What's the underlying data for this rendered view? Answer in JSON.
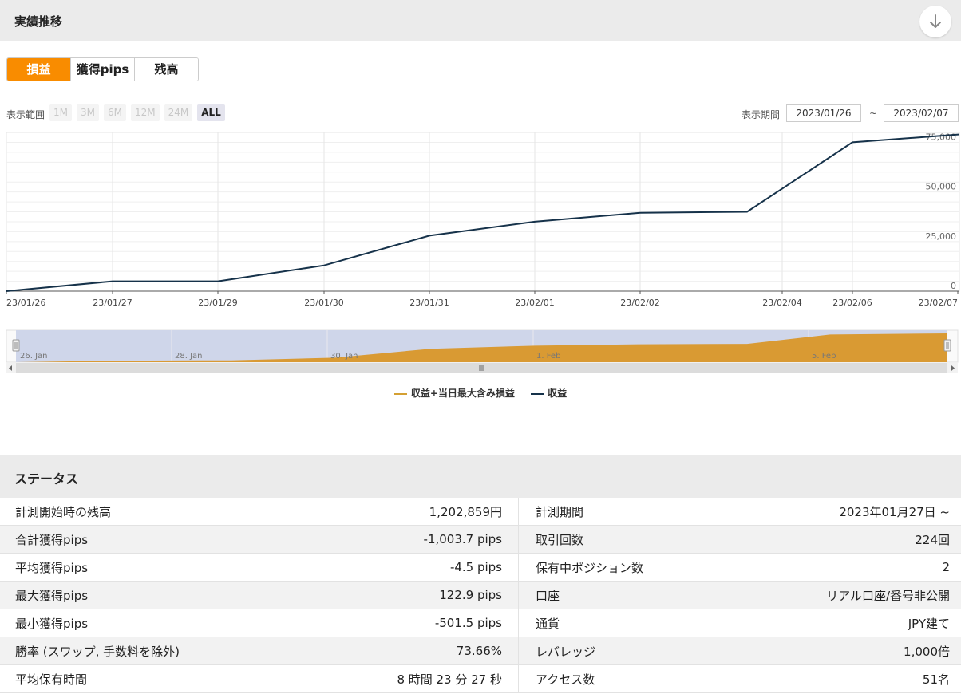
{
  "performance_section": {
    "title": "実績推移"
  },
  "tabs": [
    {
      "label": "損益",
      "active": true
    },
    {
      "label": "獲得pips",
      "active": false
    },
    {
      "label": "残高",
      "active": false
    }
  ],
  "range": {
    "label": "表示範囲",
    "buttons": [
      {
        "label": "1M",
        "active": false
      },
      {
        "label": "3M",
        "active": false
      },
      {
        "label": "6M",
        "active": false
      },
      {
        "label": "12M",
        "active": false
      },
      {
        "label": "24M",
        "active": false
      },
      {
        "label": "ALL",
        "active": true
      }
    ]
  },
  "period": {
    "label": "表示期間",
    "from": "2023/01/26",
    "separator": "~",
    "to": "2023/02/07"
  },
  "chart_data": {
    "type": "line",
    "title": "",
    "xlabel": "",
    "ylabel": "",
    "x_tick_labels": [
      "23/01/26",
      "23/01/27",
      "23/01/29",
      "23/01/30",
      "23/01/31",
      "23/02/01",
      "23/02/02",
      "23/02/04",
      "23/02/06",
      "23/02/07"
    ],
    "y_tick_labels": [
      "0",
      "25,000",
      "50,000",
      "75,000"
    ],
    "y_ticks": [
      0,
      25000,
      50000,
      75000
    ],
    "ylim": [
      0,
      80000
    ],
    "series": [
      {
        "name": "収益",
        "color": "#16324a",
        "points": [
          {
            "x": "2023-01-26",
            "y": 0
          },
          {
            "x": "2023-01-27",
            "y": 5000
          },
          {
            "x": "2023-01-29",
            "y": 5000
          },
          {
            "x": "2023-01-30",
            "y": 13000
          },
          {
            "x": "2023-01-31",
            "y": 28000
          },
          {
            "x": "2023-02-01",
            "y": 35000
          },
          {
            "x": "2023-02-02",
            "y": 39500
          },
          {
            "x": "2023-02-03",
            "y": 40000
          },
          {
            "x": "2023-02-06",
            "y": 75000
          },
          {
            "x": "2023-02-07",
            "y": 79000
          }
        ]
      },
      {
        "name": "収益+当日最大含み損益",
        "color": "#d4a033"
      }
    ],
    "grid": true,
    "legend_position": "bottom",
    "navigator": {
      "labels": [
        "26. Jan",
        "28. Jan",
        "30. Jan",
        "1. Feb",
        "5. Feb"
      ],
      "fill_color": "#d99a33",
      "selection_color": "#cfd6ea"
    }
  },
  "status_section": {
    "title": "ステータス",
    "rows": [
      {
        "label": "計測開始時の残高",
        "value": "1,202,859円",
        "label2": "計測期間",
        "value2": "2023年01月27日 ~"
      },
      {
        "label": "合計獲得pips",
        "value": "-1,003.7 pips",
        "label2": "取引回数",
        "value2": "224回"
      },
      {
        "label": "平均獲得pips",
        "value": "-4.5 pips",
        "label2": "保有中ポジション数",
        "value2": "2"
      },
      {
        "label": "最大獲得pips",
        "value": "122.9 pips",
        "label2": "口座",
        "value2": "リアル口座/番号非公開"
      },
      {
        "label": "最小獲得pips",
        "value": "-501.5 pips",
        "label2": "通貨",
        "value2": "JPY建て"
      },
      {
        "label": "勝率 (スワップ, 手数料を除外)",
        "value": "73.66%",
        "label2": "レバレッジ",
        "value2": "1,000倍"
      },
      {
        "label": "平均保有時間",
        "value": "8 時間 23 分 27 秒",
        "label2": "アクセス数",
        "value2": "51名"
      }
    ]
  },
  "colors": {
    "accent": "#f98c00",
    "line": "#16324a",
    "area": "#d99a33"
  },
  "icons": {
    "download": "arrow-down-icon"
  }
}
